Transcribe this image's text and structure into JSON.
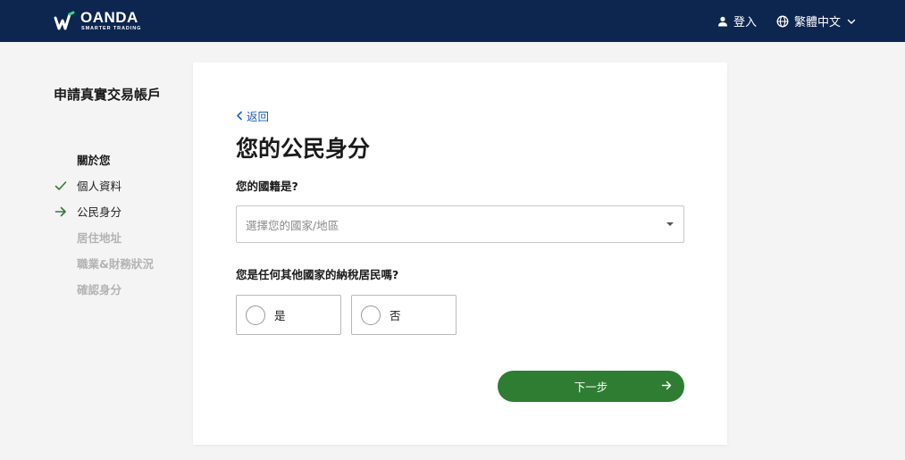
{
  "header": {
    "logo_name": "OANDA",
    "logo_tagline": "SMARTER TRADING",
    "login_label": "登入",
    "language_label": "繁體中文"
  },
  "sidebar": {
    "title": "申請真實交易帳戶",
    "steps": [
      {
        "label": "關於您",
        "state": "section"
      },
      {
        "label": "個人資料",
        "state": "done"
      },
      {
        "label": "公民身分",
        "state": "current"
      },
      {
        "label": "居住地址",
        "state": "pending"
      },
      {
        "label": "職業&財務狀況",
        "state": "pending"
      },
      {
        "label": "確認身分",
        "state": "pending"
      }
    ]
  },
  "form": {
    "back_label": "返回",
    "title": "您的公民身分",
    "nationality_question": "您的國籍是?",
    "nationality_placeholder": "選擇您的國家/地區",
    "tax_question": "您是任何其他國家的納稅居民嗎?",
    "option_yes": "是",
    "option_no": "否",
    "next_label": "下一步"
  },
  "colors": {
    "header_bg": "#0d2650",
    "accent_green": "#2e7d32",
    "link_blue": "#1f5fbf"
  },
  "icons": {
    "login": "person-icon",
    "language": "globe-icon",
    "language_toggle": "chevron-down-icon",
    "back": "chevron-left-icon",
    "select_toggle": "caret-down-icon",
    "step_done": "check-icon",
    "step_current": "arrow-right-icon",
    "next": "arrow-right-icon"
  }
}
